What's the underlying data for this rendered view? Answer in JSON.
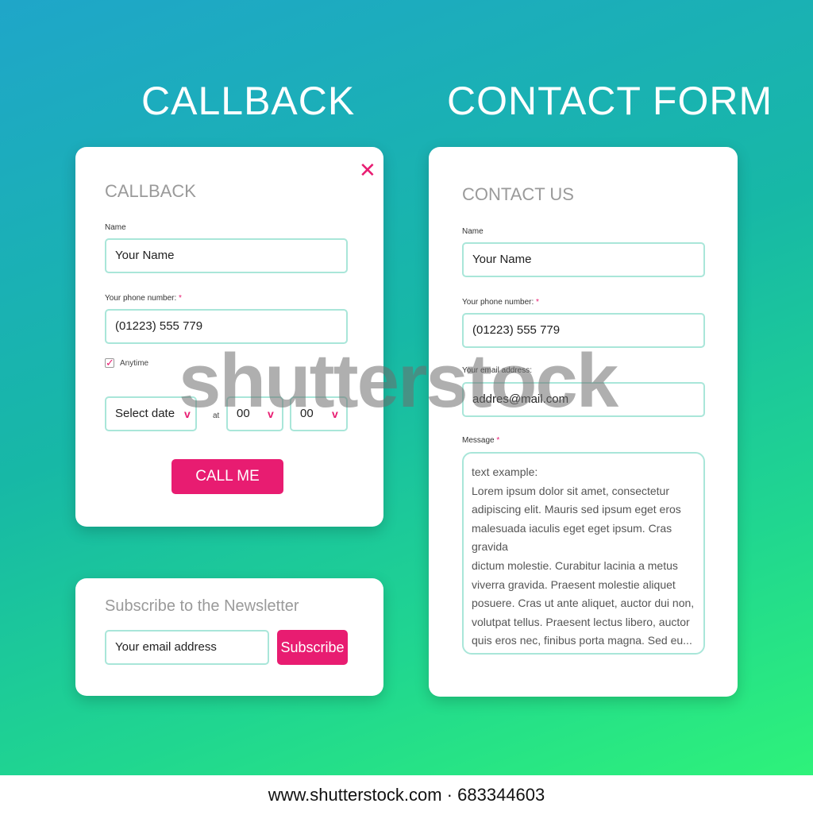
{
  "headings": {
    "callback": "CALLBACK",
    "contact_form": "CONTACT FORM"
  },
  "callback_card": {
    "close_icon": "close-icon",
    "title": "CALLBACK",
    "name_label": "Name",
    "name_value": "Your Name",
    "phone_label": "Your phone number:",
    "required_mark": "*",
    "phone_value": "(01223)  555 779",
    "anytime_checked": true,
    "anytime_label": "Anytime",
    "date_select": "Select date",
    "at_label": "at",
    "hour_select": "00",
    "minute_select": "00",
    "button_label": "CALL ME"
  },
  "newsletter_card": {
    "title": "Subscribe to the Newsletter",
    "email_value": "Your email address",
    "button_label": "Subscribe"
  },
  "contact_card": {
    "title": "CONTACT US",
    "name_label": "Name",
    "name_value": "Your Name",
    "phone_label": "Your phone number:",
    "required_mark": "*",
    "phone_value": "(01223)  555 779",
    "email_label": "Your email address:",
    "email_value": "addres@mail.com",
    "message_label": "Message",
    "message_lines": [
      "text example:",
      "Lorem ipsum dolor sit amet, consectetur",
      "adipiscing elit. Mauris sed ipsum eget eros",
      "malesuada iaculis eget eget ipsum. Cras gravida",
      "dictum molestie. Curabitur lacinia a metus",
      "viverra gravida. Praesent molestie aliquet",
      "posuere. Cras ut ante aliquet, auctor dui non,",
      "volutpat tellus. Praesent lectus libero, auctor",
      "quis eros nec, finibus porta magna. Sed eu..."
    ]
  },
  "watermark": "shutterstock",
  "footer": "www.shutterstock.com · 683344603",
  "colors": {
    "accent": "#e81c71",
    "field_border": "#a9e6d9",
    "gradient_start": "#1fa6c9",
    "gradient_end": "#2ef27a"
  }
}
